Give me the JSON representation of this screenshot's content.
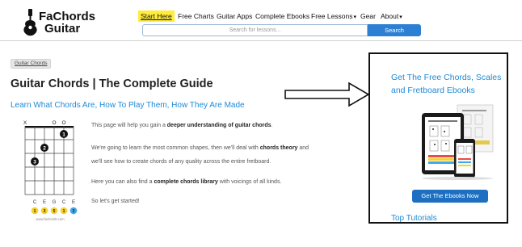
{
  "header": {
    "logo_line1": "FaChords",
    "logo_line2": "Guitar",
    "nav": [
      {
        "label": "Start Here",
        "chevron": false
      },
      {
        "label": "Free Charts",
        "chevron": false
      },
      {
        "label": "Guitar Apps",
        "chevron": false
      },
      {
        "label": "Complete Ebooks",
        "chevron": false
      },
      {
        "label": "Free Lessons",
        "chevron": true
      },
      {
        "label": "Gear",
        "chevron": false
      },
      {
        "label": "About",
        "chevron": true
      }
    ],
    "search_placeholder": "Search for lessons...",
    "search_button": "Search",
    "highlight_color": "#ffec3d"
  },
  "main": {
    "breadcrumb": "Guitar Chords",
    "title": "Guitar Chords | The Complete Guide",
    "subtitle": "Learn What Chords Are, How To Play Them, How They Are Made",
    "chord_diagram": {
      "top_markers": [
        "X",
        "O",
        "O"
      ],
      "finger_numbers": [
        "1",
        "2",
        "3"
      ],
      "notes": [
        "C",
        "E",
        "G",
        "C",
        "E"
      ],
      "intervals": [
        "1",
        "3",
        "5",
        "1",
        "3"
      ],
      "watermark": "www.fachords.com"
    },
    "paragraphs": [
      {
        "before": "This page will help you gain a ",
        "bold": "deeper understanding of guitar chords",
        "after": "."
      },
      {
        "before": "We're going to learn the most common shapes, then we'll deal with ",
        "bold": "chords theory",
        "after": " and"
      },
      {
        "before": "we'll see how to create chords of any quality across the entire fretboard.",
        "bold": "",
        "after": ""
      },
      {
        "before": "Here you can also find a ",
        "bold": "complete chords library",
        "after": " with voicings of all kinds."
      },
      {
        "before": "So let's get started!",
        "bold": "",
        "after": ""
      }
    ]
  },
  "sidebar": {
    "heading": "Get The Free Chords, Scales and Fretboard Ebooks",
    "cta": "Get The Ebooks Now",
    "section": "Top Tutorials"
  },
  "colors": {
    "link_blue": "#1e8ad6",
    "button_blue": "#2d7fd3",
    "cta_blue": "#1d6fc2",
    "interval_yellow": "#f5d22e",
    "interval_blue": "#43a6e8"
  }
}
